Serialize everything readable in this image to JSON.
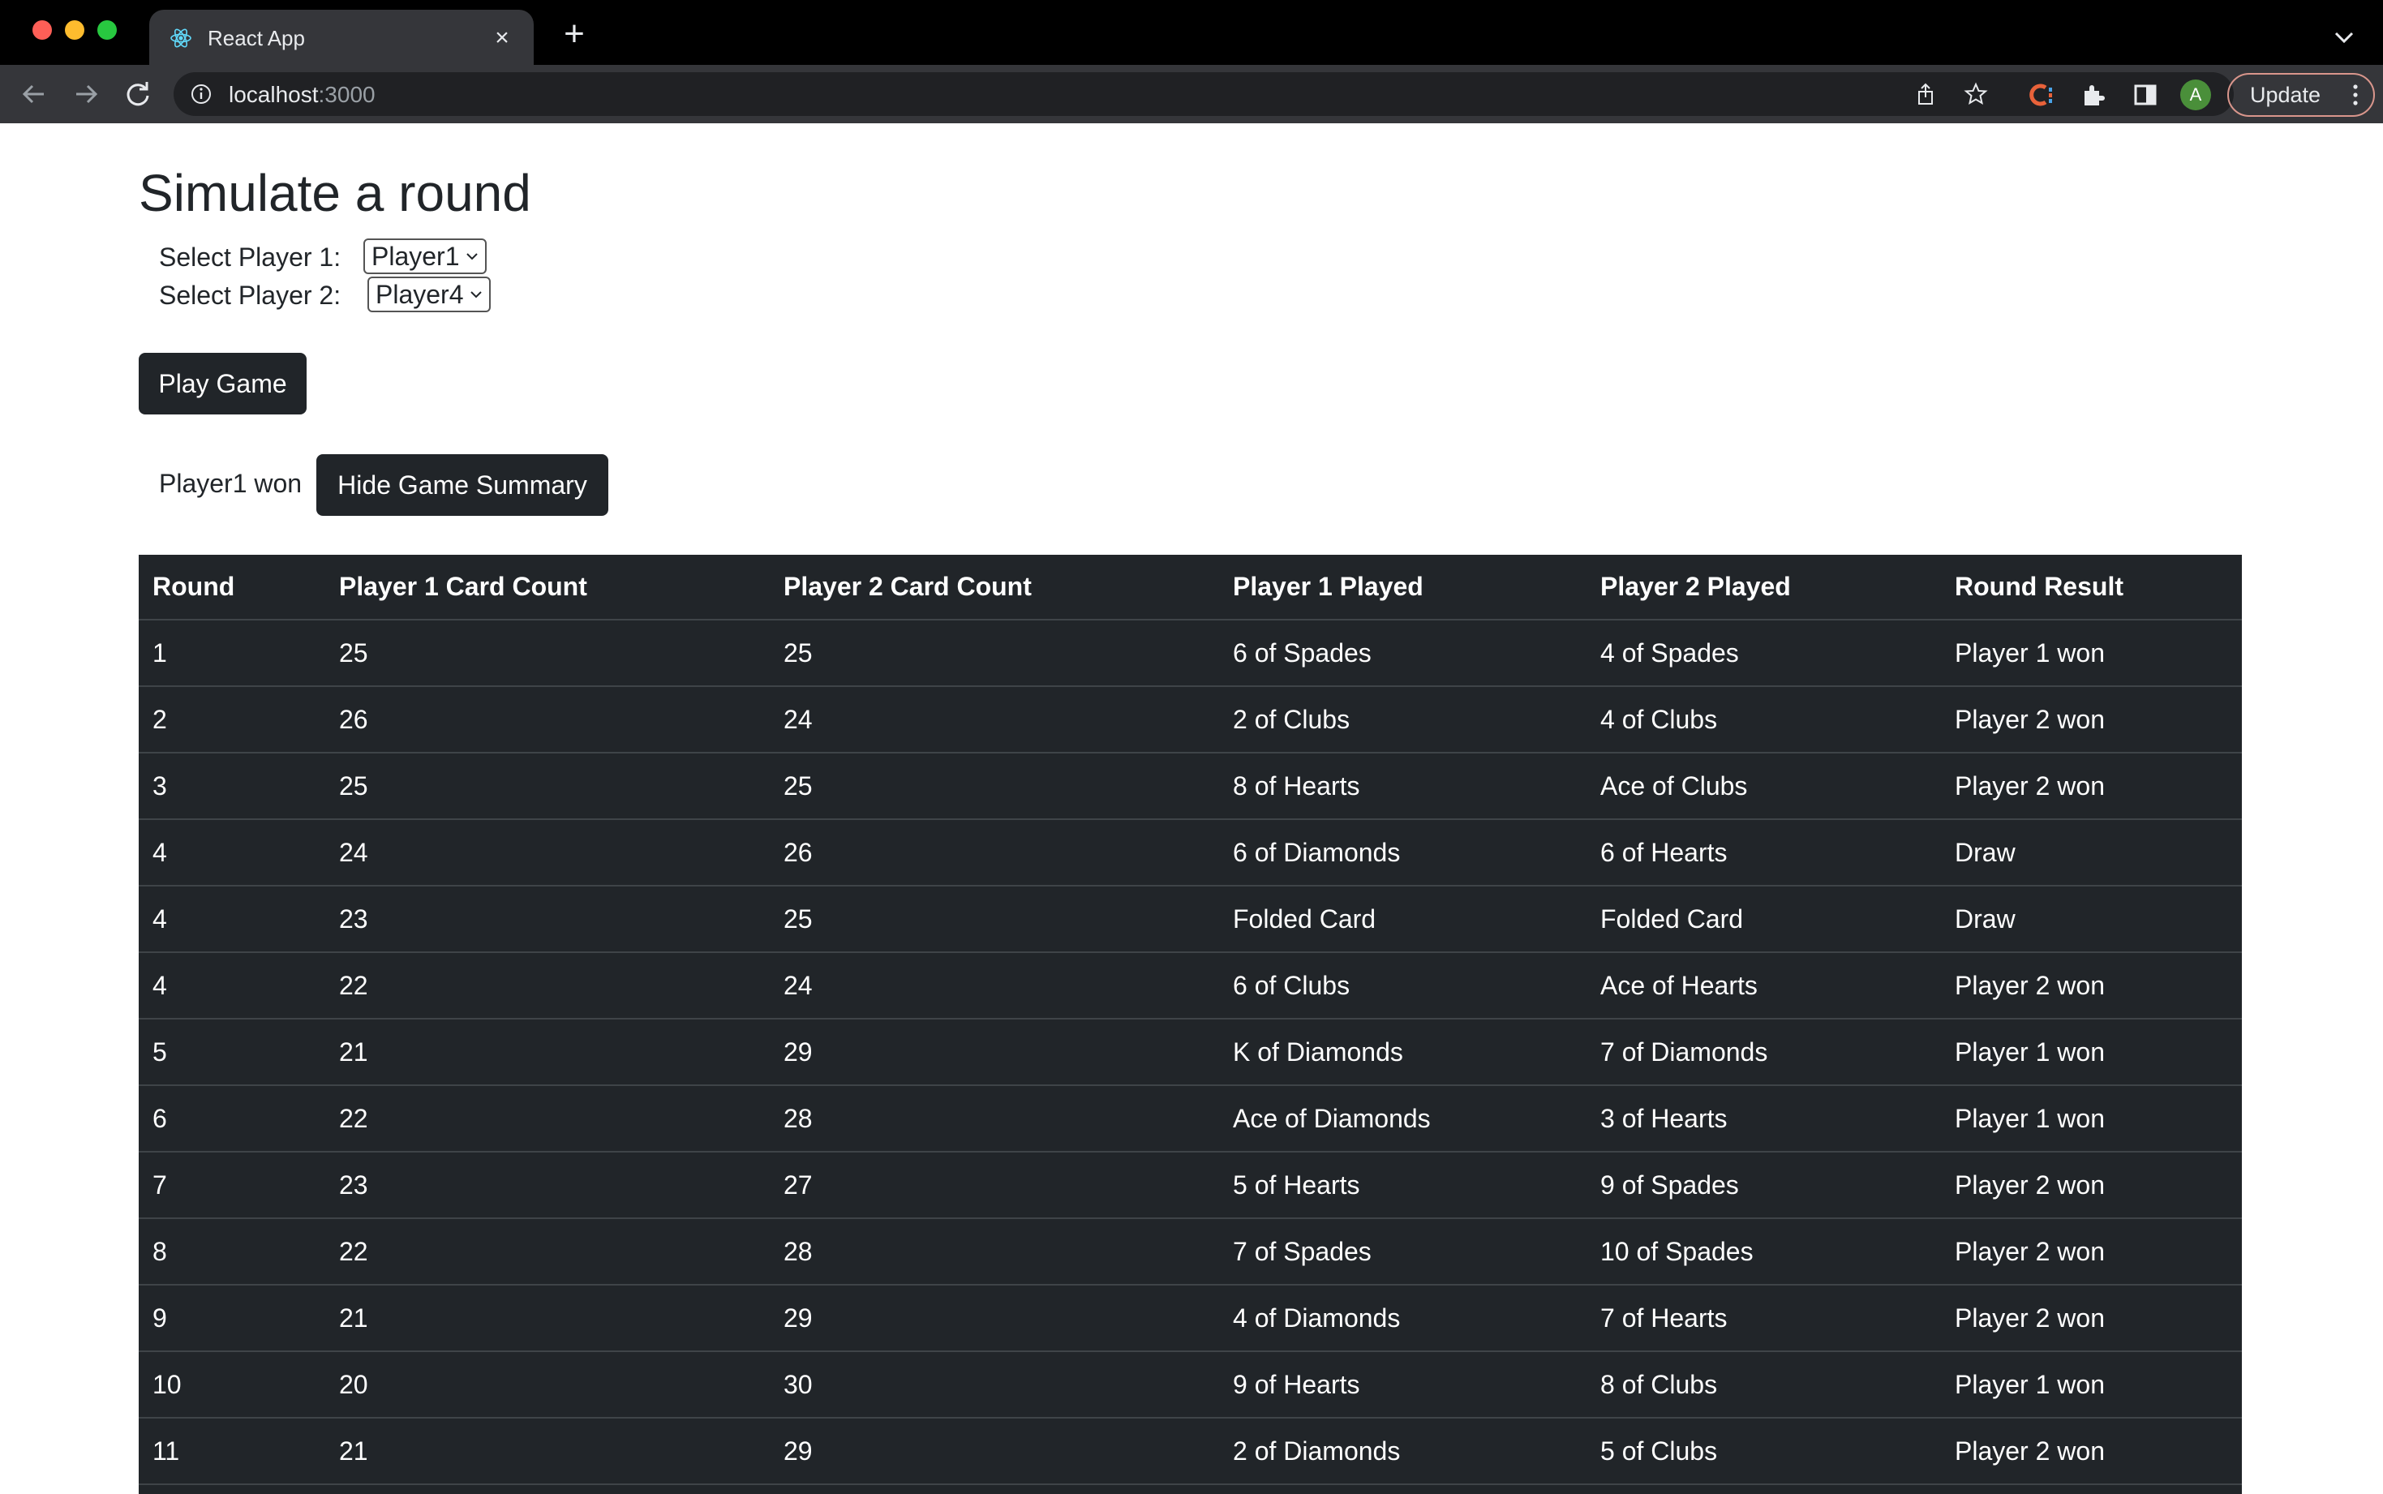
{
  "browser": {
    "tab_title": "React App",
    "url_host": "localhost",
    "url_port": ":3000",
    "avatar_letter": "A",
    "update_label": "Update"
  },
  "page": {
    "title": "Simulate a round",
    "player1_label": "Select Player 1:",
    "player1_value": "Player1",
    "player2_label": "Select Player 2:",
    "player2_value": "Player4",
    "play_button": "Play Game",
    "result_text": "Player1 won",
    "summary_button": "Hide Game Summary"
  },
  "table": {
    "headers": [
      "Round",
      "Player 1 Card Count",
      "Player 2 Card Count",
      "Player 1 Played",
      "Player 2 Played",
      "Round Result"
    ],
    "rows": [
      [
        "1",
        "25",
        "25",
        "6 of Spades",
        "4 of Spades",
        "Player 1 won"
      ],
      [
        "2",
        "26",
        "24",
        "2 of Clubs",
        "4 of Clubs",
        "Player 2 won"
      ],
      [
        "3",
        "25",
        "25",
        "8 of Hearts",
        "Ace of Clubs",
        "Player 2 won"
      ],
      [
        "4",
        "24",
        "26",
        "6 of Diamonds",
        "6 of Hearts",
        "Draw"
      ],
      [
        "4",
        "23",
        "25",
        "Folded Card",
        "Folded Card",
        "Draw"
      ],
      [
        "4",
        "22",
        "24",
        "6 of Clubs",
        "Ace of Hearts",
        "Player 2 won"
      ],
      [
        "5",
        "21",
        "29",
        "K of Diamonds",
        "7 of Diamonds",
        "Player 1 won"
      ],
      [
        "6",
        "22",
        "28",
        "Ace of Diamonds",
        "3 of Hearts",
        "Player 1 won"
      ],
      [
        "7",
        "23",
        "27",
        "5 of Hearts",
        "9 of Spades",
        "Player 2 won"
      ],
      [
        "8",
        "22",
        "28",
        "7 of Spades",
        "10 of Spades",
        "Player 2 won"
      ],
      [
        "9",
        "21",
        "29",
        "4 of Diamonds",
        "7 of Hearts",
        "Player 2 won"
      ],
      [
        "10",
        "20",
        "30",
        "9 of Hearts",
        "8 of Clubs",
        "Player 1 won"
      ],
      [
        "11",
        "21",
        "29",
        "2 of Diamonds",
        "5 of Clubs",
        "Player 2 won"
      ]
    ]
  },
  "colors": {
    "table_bg": "#212529",
    "button_bg": "#212529",
    "chrome_bg": "#35363a"
  }
}
